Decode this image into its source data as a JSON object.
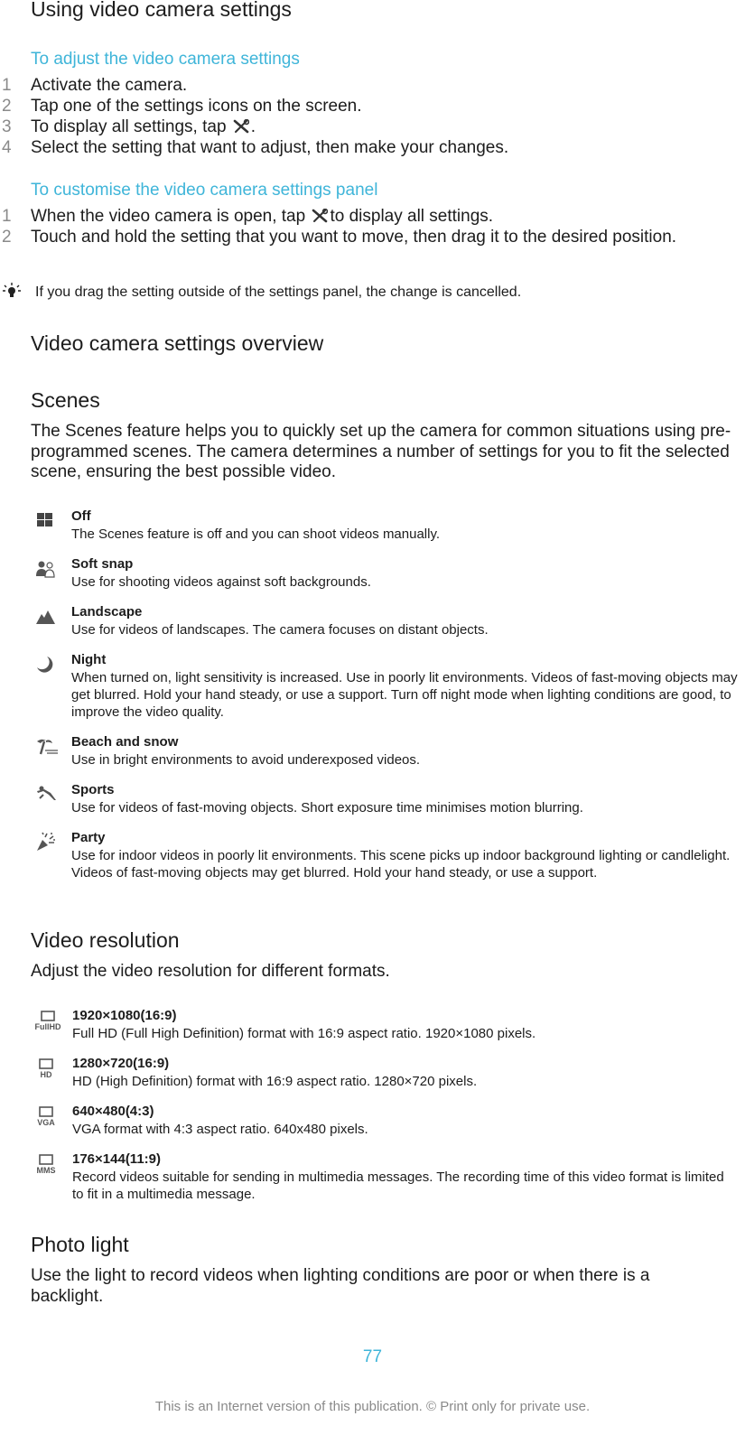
{
  "page_title": "Using video camera settings",
  "adjust_section": {
    "heading": "To adjust the video camera settings",
    "steps": [
      {
        "num": "1",
        "text": "Activate the camera."
      },
      {
        "num": "2",
        "text": "Tap one of the settings icons on the screen."
      },
      {
        "num": "3",
        "text_before": "To display all settings, tap",
        "icon": "tools-icon",
        "text_after": "."
      },
      {
        "num": "4",
        "text": "Select the setting that want to adjust, then make your changes."
      }
    ]
  },
  "customise_section": {
    "heading": "To customise the video camera settings panel",
    "steps": [
      {
        "num": "1",
        "text_before": "When the video camera is open, tap",
        "icon": "tools-icon",
        "text_after": "to display all settings."
      },
      {
        "num": "2",
        "text": "Touch and hold the setting that you want to move, then drag it to the desired position."
      }
    ]
  },
  "tip": {
    "icon": "lightbulb-icon",
    "text": "If you drag the setting outside of the settings panel, the change is cancelled."
  },
  "overview_heading": "Video camera settings overview",
  "scenes": {
    "heading": "Scenes",
    "intro": "The Scenes feature helps you to quickly set up the camera for common situations using pre-programmed scenes. The camera determines a number of settings for you to fit the selected scene, ensuring the best possible video.",
    "items": [
      {
        "icon": "grid-off-icon",
        "title": "Off",
        "desc": "The Scenes feature is off and you can shoot videos manually."
      },
      {
        "icon": "soft-snap-icon",
        "title": "Soft snap",
        "desc": "Use for shooting videos against soft backgrounds."
      },
      {
        "icon": "mountain-icon",
        "title": "Landscape",
        "desc": "Use for videos of landscapes. The camera focuses on distant objects."
      },
      {
        "icon": "moon-icon",
        "title": "Night",
        "desc": "When turned on, light sensitivity is increased. Use in poorly lit environments. Videos of fast-moving objects may get blurred. Hold your hand steady, or use a support. Turn off night mode when lighting conditions are good, to improve the video quality."
      },
      {
        "icon": "palm-tree-icon",
        "title": "Beach and snow",
        "desc": "Use in bright environments to avoid underexposed videos."
      },
      {
        "icon": "runner-icon",
        "title": "Sports",
        "desc": "Use for videos of fast-moving objects. Short exposure time minimises motion blurring."
      },
      {
        "icon": "party-popper-icon",
        "title": "Party",
        "desc": "Use for indoor videos in poorly lit environments. This scene picks up indoor background lighting or candlelight. Videos of fast-moving objects may get blurred. Hold your hand steady, or use a support."
      }
    ]
  },
  "video_resolution": {
    "heading": "Video resolution",
    "intro": "Adjust the video resolution for different formats.",
    "items": [
      {
        "icon": "fullhd-icon",
        "icon_label": "FullHD",
        "title": "1920×1080(16:9)",
        "desc": "Full HD (Full High Definition) format with 16:9 aspect ratio. 1920×1080 pixels."
      },
      {
        "icon": "hd-icon",
        "icon_label": "HD",
        "title": "1280×720(16:9)",
        "desc": "HD (High Definition) format with 16:9 aspect ratio. 1280×720 pixels."
      },
      {
        "icon": "vga-icon",
        "icon_label": "VGA",
        "title": "640×480(4:3)",
        "desc": "VGA format with 4:3 aspect ratio. 640x480 pixels."
      },
      {
        "icon": "mms-icon",
        "icon_label": "MMS",
        "title": "176×144(11:9)",
        "desc": "Record videos suitable for sending in multimedia messages. The recording time of this video format is limited to fit in a multimedia message."
      }
    ]
  },
  "photo_light": {
    "heading": "Photo light",
    "intro": "Use the light to record videos when lighting conditions are poor or when there is a backlight."
  },
  "page_number": "77",
  "footer": "This is an Internet version of this publication. © Print only for private use."
}
